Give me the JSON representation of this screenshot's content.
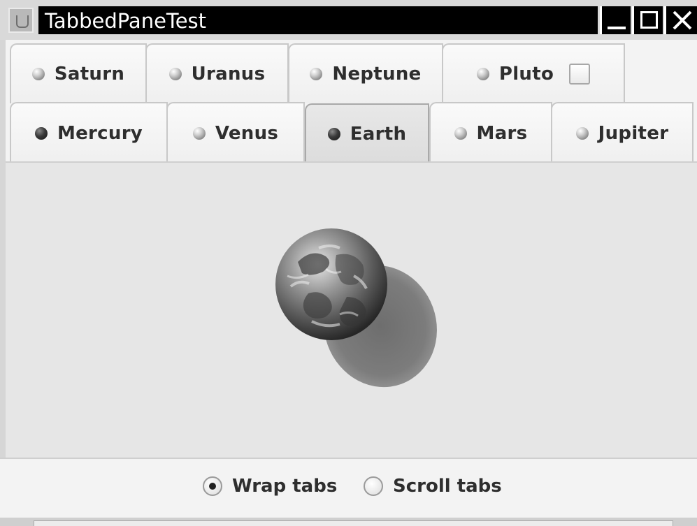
{
  "window": {
    "title": "TabbedPaneTest"
  },
  "tabs": {
    "row_top": [
      {
        "label": "Saturn",
        "icon": "planet-ball-icon"
      },
      {
        "label": "Uranus",
        "icon": "planet-ball-icon"
      },
      {
        "label": "Neptune",
        "icon": "planet-ball-icon"
      },
      {
        "label": "Pluto",
        "icon": "planet-ball-icon",
        "has_checkbox": true,
        "checkbox_checked": false
      }
    ],
    "row_bottom": [
      {
        "label": "Mercury",
        "icon": "planet-ball-dark-icon"
      },
      {
        "label": "Venus",
        "icon": "planet-ball-icon"
      },
      {
        "label": "Earth",
        "icon": "planet-ball-dark-icon",
        "selected": true
      },
      {
        "label": "Mars",
        "icon": "planet-ball-icon"
      },
      {
        "label": "Jupiter",
        "icon": "planet-ball-icon"
      }
    ]
  },
  "content": {
    "image": "earth-globe-with-shadow"
  },
  "options": {
    "wrap_label": "Wrap tabs",
    "scroll_label": "Scroll tabs",
    "selected": "wrap"
  }
}
